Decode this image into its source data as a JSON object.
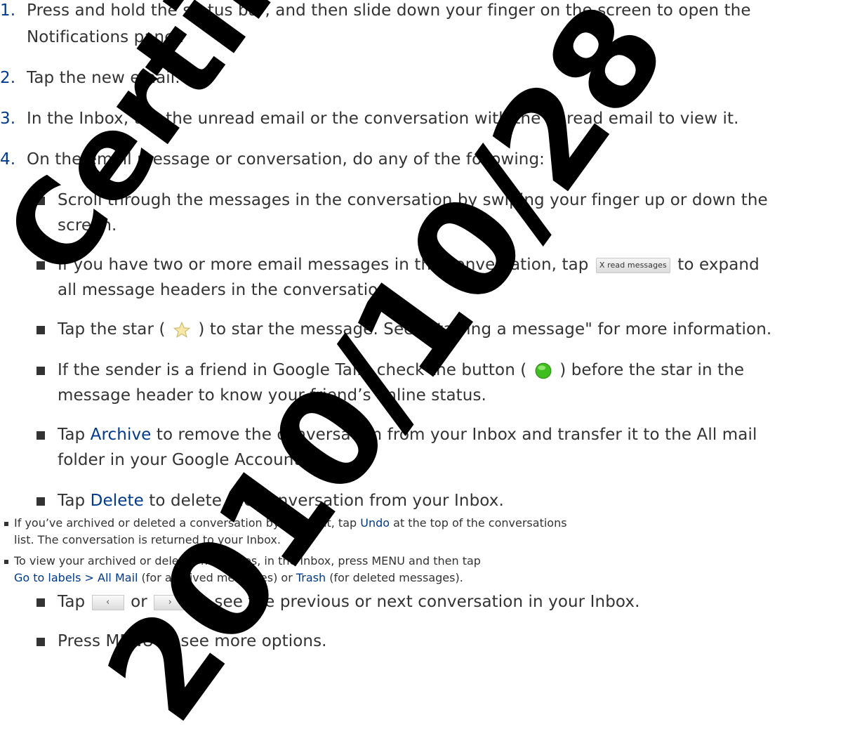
{
  "steps": {
    "s1": {
      "num": "1.",
      "line1": "Press and hold the status bar, and then slide down your finger on the screen to open the",
      "line2": "Notifications panel."
    },
    "s2": {
      "num": "2.",
      "text": "Tap the new email."
    },
    "s3": {
      "num": "3.",
      "text": "In the Inbox, tap the unread email or the conversation with the unread email to view it."
    },
    "s4": {
      "num": "4.",
      "text": "On the email message or conversation, do any of the following:"
    }
  },
  "bullets": {
    "b1": {
      "line1": "Scroll through the messages in the conversation by swiping your finger up or down the",
      "line2": "screen."
    },
    "b2": {
      "pre": "If you have two or more email messages in the conversation, tap",
      "button": "X read messages",
      "post": "to expand",
      "line2": "all message headers in the conversation."
    },
    "b3": {
      "pre": "Tap the star (",
      "post": ") to star the message. See \"Starring a message\" for more information."
    },
    "b4": {
      "pre": "If the sender is a friend in Google Talk, check the button (",
      "post": ") before the star in the",
      "line2": "message header to know your friend’s online status."
    },
    "b5": {
      "pre": "Tap",
      "kw": "Archive",
      "post": "to remove the conversation from your Inbox and transfer it to the All mail",
      "line2": "folder in your Google Account."
    },
    "b6": {
      "pre": "Tap",
      "kw": "Delete",
      "post": "to delete the conversation from your Inbox."
    },
    "b9": {
      "pre": "Tap",
      "mid": "or",
      "post": "to see the previous or next conversation in your Inbox."
    },
    "b10": {
      "text": "Press MENU to see more options."
    }
  },
  "notes": {
    "n1": {
      "pre": "If you’ve archived or deleted a conversation by accident, tap",
      "kw": "Undo",
      "post": "at the top of the conversations",
      "line2": "list. The conversation is returned to your Inbox."
    },
    "n2": {
      "line1": "To view your archived or deleted messages, in the Inbox, press MENU and then tap",
      "kw1": "Go to labels > All Mail",
      "mid": "(for archived messages) or",
      "kw2": "Trash",
      "post": "(for deleted messages)."
    }
  },
  "icons": {
    "prev": "‹",
    "next": "›"
  },
  "watermark": {
    "line1": "Certified",
    "line2": "2010/10/28"
  },
  "colors": {
    "text": "#333333",
    "keyword": "#003a8c",
    "star": "#f2b705",
    "online": "#3fbf1f"
  }
}
